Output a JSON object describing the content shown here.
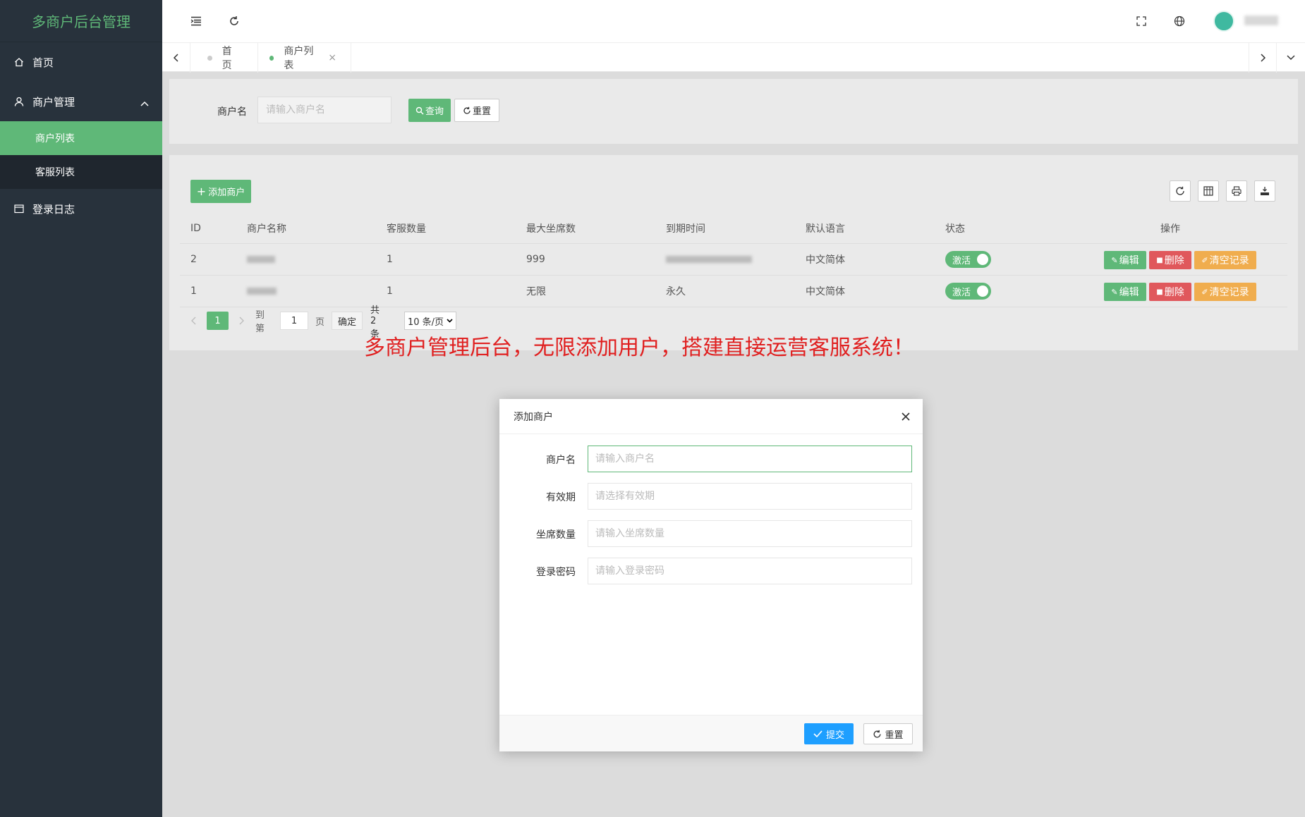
{
  "app": {
    "title": "多商户后台管理"
  },
  "sidebar": {
    "items": [
      {
        "label": "首页",
        "icon": "home-icon"
      },
      {
        "label": "商户管理",
        "icon": "user-icon",
        "expanded": true,
        "children": [
          {
            "label": "商户列表",
            "active": true
          },
          {
            "label": "客服列表"
          }
        ]
      },
      {
        "label": "登录日志",
        "icon": "calendar-icon"
      }
    ]
  },
  "header": {
    "icons": [
      "menu-fold-icon",
      "refresh-icon",
      "fullscreen-icon",
      "globe-icon",
      "avatar"
    ]
  },
  "tabs": [
    {
      "label": "首页",
      "active": false
    },
    {
      "label": "商户列表",
      "active": true,
      "closable": true,
      "close_glyph": "×"
    }
  ],
  "search": {
    "label": "商户名",
    "placeholder": "请输入商户名",
    "query_label": "查询",
    "reset_label": "重置"
  },
  "table": {
    "add_label": "添加商户",
    "columns": [
      "ID",
      "商户名称",
      "客服数量",
      "最大坐席数",
      "到期时间",
      "默认语言",
      "状态",
      "操作"
    ],
    "rows": [
      {
        "id": "2",
        "seats": "1",
        "max_seats": "999",
        "expire": "",
        "language": "中文简体",
        "status": "激活"
      },
      {
        "id": "1",
        "seats": "1",
        "max_seats": "无限",
        "expire": "永久",
        "language": "中文简体",
        "status": "激活"
      }
    ],
    "actions": {
      "edit": "编辑",
      "delete": "删除",
      "clear": "清空记录"
    }
  },
  "pagination": {
    "current_page": "1",
    "goto_label": "到第",
    "goto_value": "1",
    "page_label": "页",
    "confirm_label": "确定",
    "total_label": "共 2 条",
    "page_size": "10 条/页"
  },
  "promo_text": "多商户管理后台，无限添加用户，搭建直接运营客服系统！",
  "modal": {
    "title": "添加商户",
    "fields": [
      {
        "label": "商户名",
        "placeholder": "请输入商户名"
      },
      {
        "label": "有效期",
        "placeholder": "请选择有效期"
      },
      {
        "label": "坐席数量",
        "placeholder": "请输入坐席数量"
      },
      {
        "label": "登录密码",
        "placeholder": "请输入登录密码"
      }
    ],
    "submit_label": "提交",
    "reset_label": "重置"
  },
  "colors": {
    "accent": "#5fb878",
    "sidebar": "#28323c",
    "danger": "#e0585c",
    "warning": "#f0ad4e",
    "primary": "#1e9fff",
    "promo": "#e02020"
  }
}
